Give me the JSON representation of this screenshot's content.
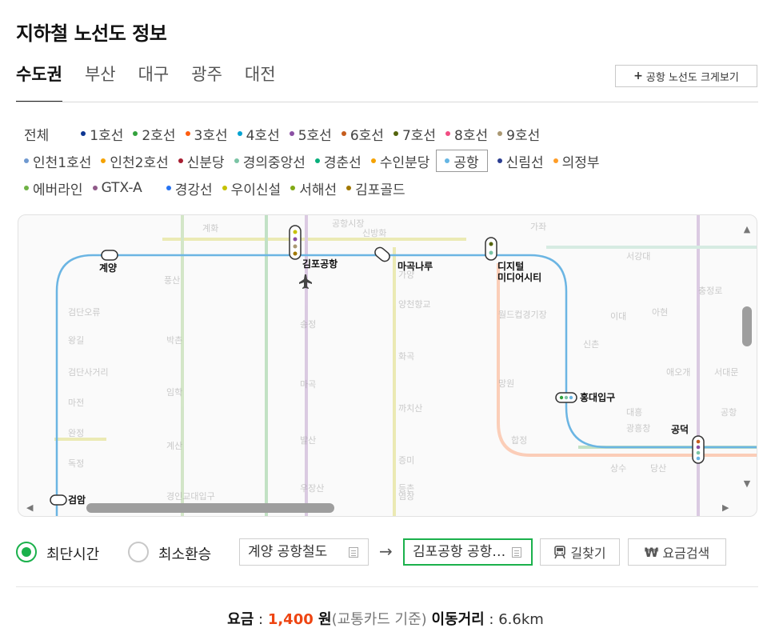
{
  "page_title": "지하철 노선도 정보",
  "region_tabs": [
    {
      "label": "수도권",
      "active": true
    },
    {
      "label": "부산",
      "active": false
    },
    {
      "label": "대구",
      "active": false
    },
    {
      "label": "광주",
      "active": false
    },
    {
      "label": "대전",
      "active": false
    }
  ],
  "airport_map_button": {
    "icon": "plus-icon",
    "label": "공항 노선도 크게보기"
  },
  "line_filters": {
    "row1": [
      {
        "label": "전체",
        "color": ""
      },
      {
        "label": "1호선",
        "color": "#0d3692"
      },
      {
        "label": "2호선",
        "color": "#33a23d"
      },
      {
        "label": "3호선",
        "color": "#fe5d10"
      },
      {
        "label": "4호선",
        "color": "#00a2d1"
      },
      {
        "label": "5호선",
        "color": "#8b50a4"
      },
      {
        "label": "6호선",
        "color": "#c55c1d"
      },
      {
        "label": "7호선",
        "color": "#54640d"
      },
      {
        "label": "8호선",
        "color": "#f14c82"
      },
      {
        "label": "9호선",
        "color": "#aa9872"
      }
    ],
    "row2": [
      {
        "label": "인천1호선",
        "color": "#6f99d0"
      },
      {
        "label": "인천2호선",
        "color": "#f5a200"
      },
      {
        "label": "신분당",
        "color": "#a71e31"
      },
      {
        "label": "경의중앙선",
        "color": "#7bc4a5"
      },
      {
        "label": "경춘선",
        "color": "#08af7b"
      },
      {
        "label": "수인분당",
        "color": "#f5a200"
      },
      {
        "label": "공항",
        "color": "#65b6e4",
        "active": true
      },
      {
        "label": "신림선",
        "color": "#2b3d91"
      },
      {
        "label": "의정부",
        "color": "#ff9d27"
      }
    ],
    "row3": [
      {
        "label": "에버라인",
        "color": "#6fb245"
      },
      {
        "label": "GTX-A",
        "color": "#905a89"
      },
      {
        "label": "경강선",
        "color": "#2673f2"
      },
      {
        "label": "우이신설",
        "color": "#c6c100"
      },
      {
        "label": "서해선",
        "color": "#81a914"
      },
      {
        "label": "김포골드",
        "color": "#a17800"
      }
    ]
  },
  "map": {
    "route_color": "#6bb5e3",
    "stations": [
      {
        "name": "계양"
      },
      {
        "name": "김포공항"
      },
      {
        "name": "마곡나루"
      },
      {
        "name": "디지털"
      },
      {
        "name": "미디어시티"
      },
      {
        "name": "홍대입구"
      },
      {
        "name": "공덕"
      },
      {
        "name": "검암"
      }
    ],
    "airport_icon": "airplane-icon",
    "faded_labels": [
      "계화",
      "공항시장",
      "신방화",
      "가좌",
      "검단오류",
      "왕길",
      "검단사거리",
      "마전",
      "완정",
      "독정",
      "박촌",
      "임학",
      "계산",
      "경인교대입구",
      "풍산",
      "송정",
      "마곡",
      "발산",
      "우장산",
      "화곡",
      "까치산",
      "양천향교",
      "가양",
      "증미",
      "등촌",
      "염창",
      "월드컵경기장",
      "망원",
      "합정",
      "신촌",
      "이대",
      "아현",
      "애오개",
      "서강대",
      "광흥창",
      "대흥",
      "상수",
      "당산",
      "충정로",
      "서대문",
      "공항"
    ]
  },
  "search": {
    "options": [
      {
        "label": "최단시간",
        "checked": true
      },
      {
        "label": "최소환승",
        "checked": false
      }
    ],
    "from_value": "계양 공항철도",
    "to_value": "김포공항 공항철도",
    "arrow": "→",
    "route_button": {
      "icon": "train-icon",
      "label": "길찾기"
    },
    "fare_button": {
      "icon": "won-icon",
      "label": "요금검색"
    }
  },
  "fare": {
    "fare_label": "요금",
    "separator": " : ",
    "amount": "1,400",
    "unit": " 원",
    "basis": "(교통카드 기준)",
    "distance_label": "이동거리",
    "distance_value": "6.6km"
  }
}
